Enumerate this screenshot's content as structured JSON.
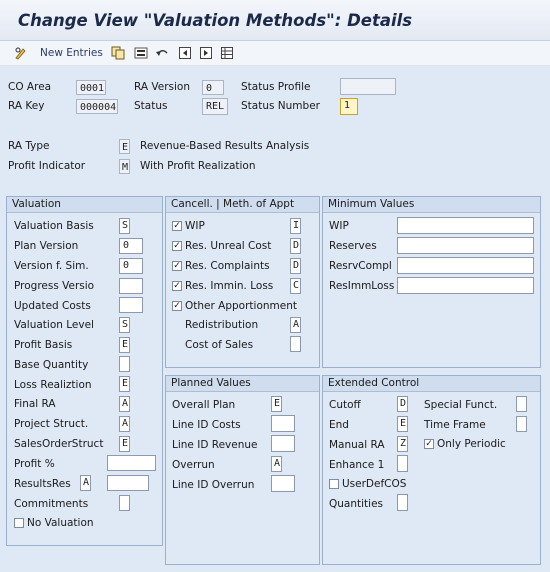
{
  "title": "Change View \"Valuation Methods\": Details",
  "toolbar": {
    "new_entries": "New Entries",
    "icons": [
      "pencil-glasses-icon",
      "copy-icon",
      "save-local-icon",
      "undo-icon",
      "first-page-icon",
      "next-page-icon",
      "table-icon"
    ]
  },
  "header": {
    "co_area_label": "CO Area",
    "co_area_value": "0001",
    "ra_version_label": "RA Version",
    "ra_version_value": "0",
    "status_profile_label": "Status Profile",
    "status_profile_value": "",
    "ra_key_label": "RA Key",
    "ra_key_value": "000004",
    "status_label": "Status",
    "status_value": "REL",
    "status_number_label": "Status Number",
    "status_number_value": "1",
    "ra_type_label": "RA Type",
    "ra_type_value": "E",
    "ra_type_text": "Revenue-Based Results Analysis",
    "profit_indicator_label": "Profit Indicator",
    "profit_indicator_value": "M",
    "profit_indicator_text": "With Profit Realization"
  },
  "valuation": {
    "title": "Valuation",
    "rows": [
      {
        "label": "Valuation Basis",
        "value": "S"
      },
      {
        "label": "Plan Version",
        "value": "0"
      },
      {
        "label": "Version f. Sim.",
        "value": "0"
      },
      {
        "label": "Progress Versio",
        "value": ""
      },
      {
        "label": "Updated Costs",
        "value": ""
      },
      {
        "label": "Valuation Level",
        "value": "S"
      },
      {
        "label": "Profit Basis",
        "value": "E"
      },
      {
        "label": "Base Quantity",
        "value": ""
      },
      {
        "label": "Loss Realiztion",
        "value": "E"
      },
      {
        "label": "Final RA",
        "value": "A"
      },
      {
        "label": "Project Struct.",
        "value": "A"
      },
      {
        "label": "SalesOrderStruct",
        "value": "E"
      },
      {
        "label": "Profit %",
        "value": ""
      },
      {
        "label": "ResultsRes",
        "value": "A",
        "value2": ""
      },
      {
        "label": "Commitments",
        "value": ""
      }
    ],
    "no_valuation_label": "No Valuation"
  },
  "cancel": {
    "title": "Cancell. | Meth. of Appt",
    "rows": [
      {
        "label": "WIP",
        "checked": true,
        "value": "I"
      },
      {
        "label": "Res. Unreal Cost",
        "checked": true,
        "value": "D"
      },
      {
        "label": "Res. Complaints",
        "checked": true,
        "value": "D"
      },
      {
        "label": "Res. Immin. Loss",
        "checked": true,
        "value": "C"
      }
    ],
    "other_apport_label": "Other Apportionment",
    "redistribution_label": "Redistribution",
    "redistribution_value": "A",
    "cost_of_sales_label": "Cost of Sales",
    "cost_of_sales_value": ""
  },
  "minimum": {
    "title": "Minimum Values",
    "rows": [
      {
        "label": "WIP",
        "value": ""
      },
      {
        "label": "Reserves",
        "value": ""
      },
      {
        "label": "ResrvCompl",
        "value": ""
      },
      {
        "label": "ResImmLoss",
        "value": ""
      }
    ]
  },
  "planned": {
    "title": "Planned Values",
    "rows": [
      {
        "label": "Overall Plan",
        "value": "E"
      },
      {
        "label": "Line ID Costs",
        "value": ""
      },
      {
        "label": "Line ID Revenue",
        "value": ""
      },
      {
        "label": "Overrun",
        "value": "A"
      },
      {
        "label": "Line ID Overrun",
        "value": ""
      }
    ]
  },
  "extended": {
    "title": "Extended Control",
    "cutoff_label": "Cutoff",
    "cutoff_value": "D",
    "special_funct_label": "Special Funct.",
    "special_funct_value": "",
    "end_label": "End",
    "end_value": "E",
    "time_frame_label": "Time Frame",
    "time_frame_value": "",
    "manual_ra_label": "Manual RA",
    "manual_ra_value": "Z",
    "only_periodic_label": "Only Periodic",
    "enhance_label": "Enhance 1",
    "enhance_value": "",
    "userdefcos_label": "UserDefCOS",
    "quantities_label": "Quantities",
    "quantities_value": ""
  }
}
